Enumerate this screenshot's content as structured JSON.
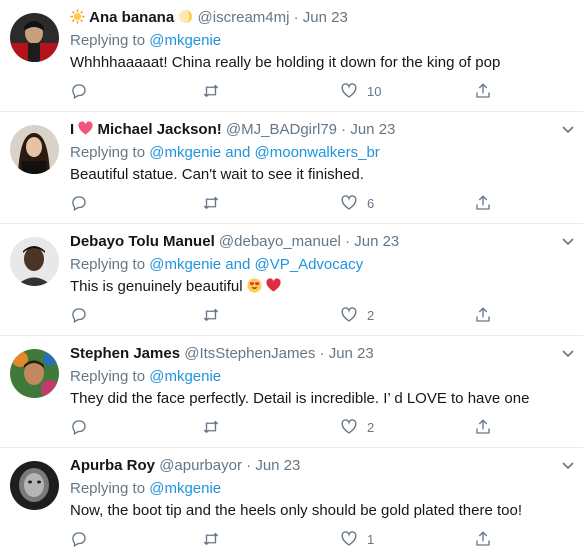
{
  "tweets": [
    {
      "name": "Ana banana",
      "handle": "@iscream4mj",
      "sep": "·",
      "date": "Jun 23",
      "replying_label": "Replying to",
      "mentions": "@mkgenie",
      "text": "Whhhhaaaaat! China really be holding it down for the king of pop",
      "likes": "10"
    },
    {
      "name_prefix": "I",
      "name": "Michael Jackson!",
      "handle": "@MJ_BADgirl79",
      "sep": "·",
      "date": "Jun 23",
      "replying_label": "Replying to",
      "mentions": "@mkgenie and @moonwalkers_br",
      "text": "Beautiful statue. Can't wait to see it finished.",
      "likes": "6"
    },
    {
      "name": "Debayo Tolu Manuel",
      "handle": "@debayo_manuel",
      "sep": "·",
      "date": "Jun 23",
      "replying_label": "Replying to",
      "mentions": "@mkgenie and @VP_Advocacy",
      "text": "This is genuinely beautiful",
      "likes": "2"
    },
    {
      "name": "Stephen James",
      "handle": "@ItsStephenJames",
      "sep": "·",
      "date": "Jun 23",
      "replying_label": "Replying to",
      "mentions": "@mkgenie",
      "text": "They did the face perfectly. Detail is incredible. I’ d LOVE to have one",
      "likes": "2"
    },
    {
      "name": "Apurba Roy",
      "handle": "@apurbayor",
      "sep": "·",
      "date": "Jun 23",
      "replying_label": "Replying to",
      "mentions": "@mkgenie",
      "text": "Now, the boot tip and the heels only should be gold plated there too!",
      "likes": "1"
    }
  ],
  "icons": {
    "reply": "reply-icon",
    "retweet": "retweet-icon",
    "like": "heart-icon",
    "share": "share-icon",
    "more": "chevron-down-icon"
  },
  "colors": {
    "link": "#1b95e0",
    "secondary_text": "#657786",
    "heart_emoji": "#e0245e",
    "divider": "#e6ecf0"
  }
}
